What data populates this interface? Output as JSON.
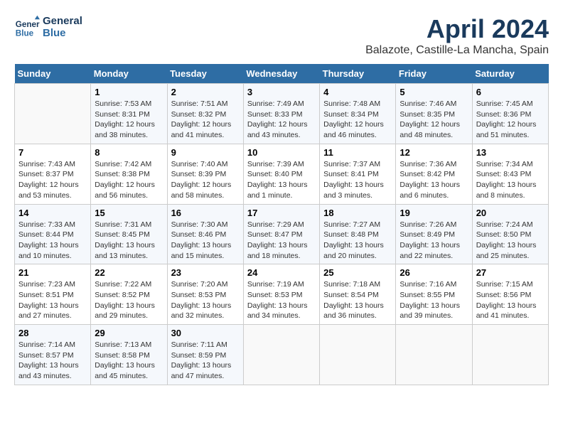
{
  "header": {
    "logo_line1": "General",
    "logo_line2": "Blue",
    "month_year": "April 2024",
    "location": "Balazote, Castille-La Mancha, Spain"
  },
  "days_of_week": [
    "Sunday",
    "Monday",
    "Tuesday",
    "Wednesday",
    "Thursday",
    "Friday",
    "Saturday"
  ],
  "weeks": [
    [
      {
        "day": "",
        "info": ""
      },
      {
        "day": "1",
        "info": "Sunrise: 7:53 AM\nSunset: 8:31 PM\nDaylight: 12 hours\nand 38 minutes."
      },
      {
        "day": "2",
        "info": "Sunrise: 7:51 AM\nSunset: 8:32 PM\nDaylight: 12 hours\nand 41 minutes."
      },
      {
        "day": "3",
        "info": "Sunrise: 7:49 AM\nSunset: 8:33 PM\nDaylight: 12 hours\nand 43 minutes."
      },
      {
        "day": "4",
        "info": "Sunrise: 7:48 AM\nSunset: 8:34 PM\nDaylight: 12 hours\nand 46 minutes."
      },
      {
        "day": "5",
        "info": "Sunrise: 7:46 AM\nSunset: 8:35 PM\nDaylight: 12 hours\nand 48 minutes."
      },
      {
        "day": "6",
        "info": "Sunrise: 7:45 AM\nSunset: 8:36 PM\nDaylight: 12 hours\nand 51 minutes."
      }
    ],
    [
      {
        "day": "7",
        "info": "Sunrise: 7:43 AM\nSunset: 8:37 PM\nDaylight: 12 hours\nand 53 minutes."
      },
      {
        "day": "8",
        "info": "Sunrise: 7:42 AM\nSunset: 8:38 PM\nDaylight: 12 hours\nand 56 minutes."
      },
      {
        "day": "9",
        "info": "Sunrise: 7:40 AM\nSunset: 8:39 PM\nDaylight: 12 hours\nand 58 minutes."
      },
      {
        "day": "10",
        "info": "Sunrise: 7:39 AM\nSunset: 8:40 PM\nDaylight: 13 hours\nand 1 minute."
      },
      {
        "day": "11",
        "info": "Sunrise: 7:37 AM\nSunset: 8:41 PM\nDaylight: 13 hours\nand 3 minutes."
      },
      {
        "day": "12",
        "info": "Sunrise: 7:36 AM\nSunset: 8:42 PM\nDaylight: 13 hours\nand 6 minutes."
      },
      {
        "day": "13",
        "info": "Sunrise: 7:34 AM\nSunset: 8:43 PM\nDaylight: 13 hours\nand 8 minutes."
      }
    ],
    [
      {
        "day": "14",
        "info": "Sunrise: 7:33 AM\nSunset: 8:44 PM\nDaylight: 13 hours\nand 10 minutes."
      },
      {
        "day": "15",
        "info": "Sunrise: 7:31 AM\nSunset: 8:45 PM\nDaylight: 13 hours\nand 13 minutes."
      },
      {
        "day": "16",
        "info": "Sunrise: 7:30 AM\nSunset: 8:46 PM\nDaylight: 13 hours\nand 15 minutes."
      },
      {
        "day": "17",
        "info": "Sunrise: 7:29 AM\nSunset: 8:47 PM\nDaylight: 13 hours\nand 18 minutes."
      },
      {
        "day": "18",
        "info": "Sunrise: 7:27 AM\nSunset: 8:48 PM\nDaylight: 13 hours\nand 20 minutes."
      },
      {
        "day": "19",
        "info": "Sunrise: 7:26 AM\nSunset: 8:49 PM\nDaylight: 13 hours\nand 22 minutes."
      },
      {
        "day": "20",
        "info": "Sunrise: 7:24 AM\nSunset: 8:50 PM\nDaylight: 13 hours\nand 25 minutes."
      }
    ],
    [
      {
        "day": "21",
        "info": "Sunrise: 7:23 AM\nSunset: 8:51 PM\nDaylight: 13 hours\nand 27 minutes."
      },
      {
        "day": "22",
        "info": "Sunrise: 7:22 AM\nSunset: 8:52 PM\nDaylight: 13 hours\nand 29 minutes."
      },
      {
        "day": "23",
        "info": "Sunrise: 7:20 AM\nSunset: 8:53 PM\nDaylight: 13 hours\nand 32 minutes."
      },
      {
        "day": "24",
        "info": "Sunrise: 7:19 AM\nSunset: 8:53 PM\nDaylight: 13 hours\nand 34 minutes."
      },
      {
        "day": "25",
        "info": "Sunrise: 7:18 AM\nSunset: 8:54 PM\nDaylight: 13 hours\nand 36 minutes."
      },
      {
        "day": "26",
        "info": "Sunrise: 7:16 AM\nSunset: 8:55 PM\nDaylight: 13 hours\nand 39 minutes."
      },
      {
        "day": "27",
        "info": "Sunrise: 7:15 AM\nSunset: 8:56 PM\nDaylight: 13 hours\nand 41 minutes."
      }
    ],
    [
      {
        "day": "28",
        "info": "Sunrise: 7:14 AM\nSunset: 8:57 PM\nDaylight: 13 hours\nand 43 minutes."
      },
      {
        "day": "29",
        "info": "Sunrise: 7:13 AM\nSunset: 8:58 PM\nDaylight: 13 hours\nand 45 minutes."
      },
      {
        "day": "30",
        "info": "Sunrise: 7:11 AM\nSunset: 8:59 PM\nDaylight: 13 hours\nand 47 minutes."
      },
      {
        "day": "",
        "info": ""
      },
      {
        "day": "",
        "info": ""
      },
      {
        "day": "",
        "info": ""
      },
      {
        "day": "",
        "info": ""
      }
    ]
  ]
}
